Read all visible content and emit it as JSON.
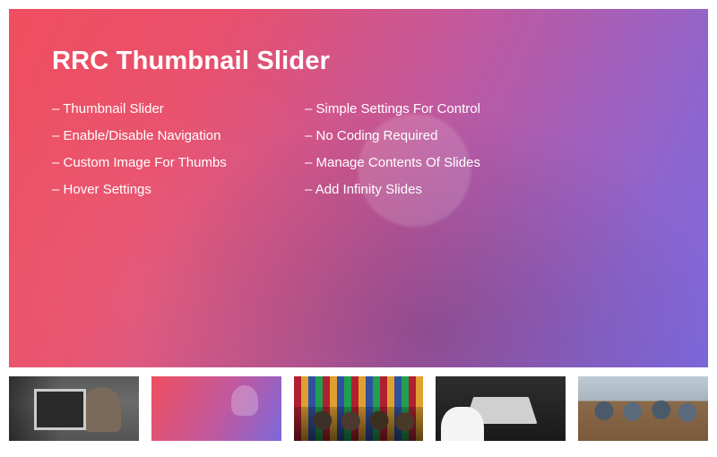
{
  "hero": {
    "title": "RRC Thumbnail Slider",
    "features_col1": [
      "Thumbnail Slider",
      "Enable/Disable Navigation",
      "Custom Image For Thumbs",
      "Hover Settings"
    ],
    "features_col2": [
      "Simple Settings For Control",
      "No Coding Required",
      "Manage Contents Of Slides",
      "Add Infinity Slides"
    ]
  },
  "thumbnails": [
    {
      "name": "thumb-workspace-monitor",
      "active": false
    },
    {
      "name": "thumb-gradient-person",
      "active": true
    },
    {
      "name": "thumb-group-bookshelf",
      "active": false
    },
    {
      "name": "thumb-laptop-dark-desk",
      "active": false
    },
    {
      "name": "thumb-team-office",
      "active": false
    }
  ]
}
